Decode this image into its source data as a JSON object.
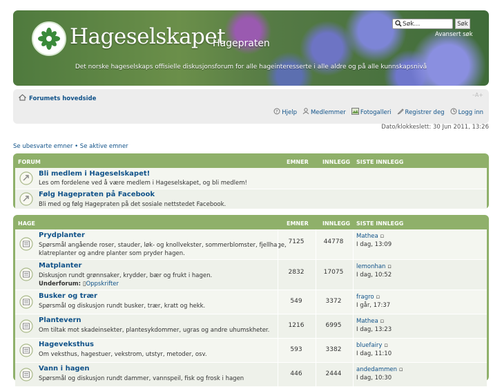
{
  "header": {
    "site_name": "Hageselskapet",
    "site_sub": "Hagepraten",
    "tagline": "Det norske hageselskaps offisielle diskusjonsforum for alle hageinteresserte i alle aldre og på alle kunnskapsnivå",
    "search_placeholder": "Søk…",
    "search_button": "Søk",
    "advanced_search": "Avansert søk"
  },
  "navbar": {
    "home": "Forumets hovedside",
    "font_control": "–A+",
    "links": [
      "Hjelp",
      "Medlemmer",
      "Fotogalleri",
      "Registrer deg",
      "Logg inn"
    ]
  },
  "date_line": "Dato/klokkeslett: 30 Jun 2011, 13:26",
  "quick_links": "Se ubesvarte emner • Se aktive emner",
  "columns": {
    "forum": "FORUM",
    "hage": "HAGE",
    "topics": "EMNER",
    "posts": "INNLEGG",
    "last": "SISTE INNLEGG"
  },
  "forum_block": [
    {
      "title": "Bli medlem i Hageselskapet!",
      "desc": "Les om fordelene ved å være medlem i Hageselskapet, og bli medlem!"
    },
    {
      "title": "Følg Hagepraten på Facebook",
      "desc": "Bli med og følg Hagepraten på det sosiale nettstedet Facebook."
    }
  ],
  "hage_block": [
    {
      "title": "Prydplanter",
      "desc1": "Spørsmål angående roser, stauder, løk- og knollvekster, sommerblomster, fjellhage,",
      "desc2": "klatreplanter og andre planter som pryder hagen.",
      "topics": "7125",
      "posts": "44778",
      "user": "Mathea",
      "time": "I dag, 13:09"
    },
    {
      "title": "Matplanter",
      "desc1": "Diskusjon rundt grønnsaker, krydder, bær og frukt i hagen.",
      "subforum_label": "Underforum:",
      "subforum": "Oppskrifter",
      "topics": "2832",
      "posts": "17075",
      "user": "lemonhan",
      "time": "I dag, 10:52"
    },
    {
      "title": "Busker og trær",
      "desc1": "Spørsmål og diskusjon rundt busker, trær, kratt og hekk.",
      "topics": "549",
      "posts": "3372",
      "user": "fragro",
      "time": "I går, 17:37"
    },
    {
      "title": "Plantevern",
      "desc1": "Om tiltak mot skadeinsekter, plantesykdommer, ugras og andre uhumskheter.",
      "topics": "1216",
      "posts": "6995",
      "user": "Mathea",
      "time": "I dag, 13:23"
    },
    {
      "title": "Hagevekst­hus",
      "desc1": "Om veksthus, hagestuer, vekstrom, utstyr, metoder, osv.",
      "topics": "593",
      "posts": "3382",
      "user": "bluefairy",
      "time": "I dag, 11:10"
    },
    {
      "title": "Vann i hagen",
      "desc1": "Spørsmål og diskusjon rundt dammer, vannspeil, fisk og frosk i hagen",
      "topics": "446",
      "posts": "2444",
      "user": "andedammen",
      "time": "I dag, 10:30"
    }
  ]
}
